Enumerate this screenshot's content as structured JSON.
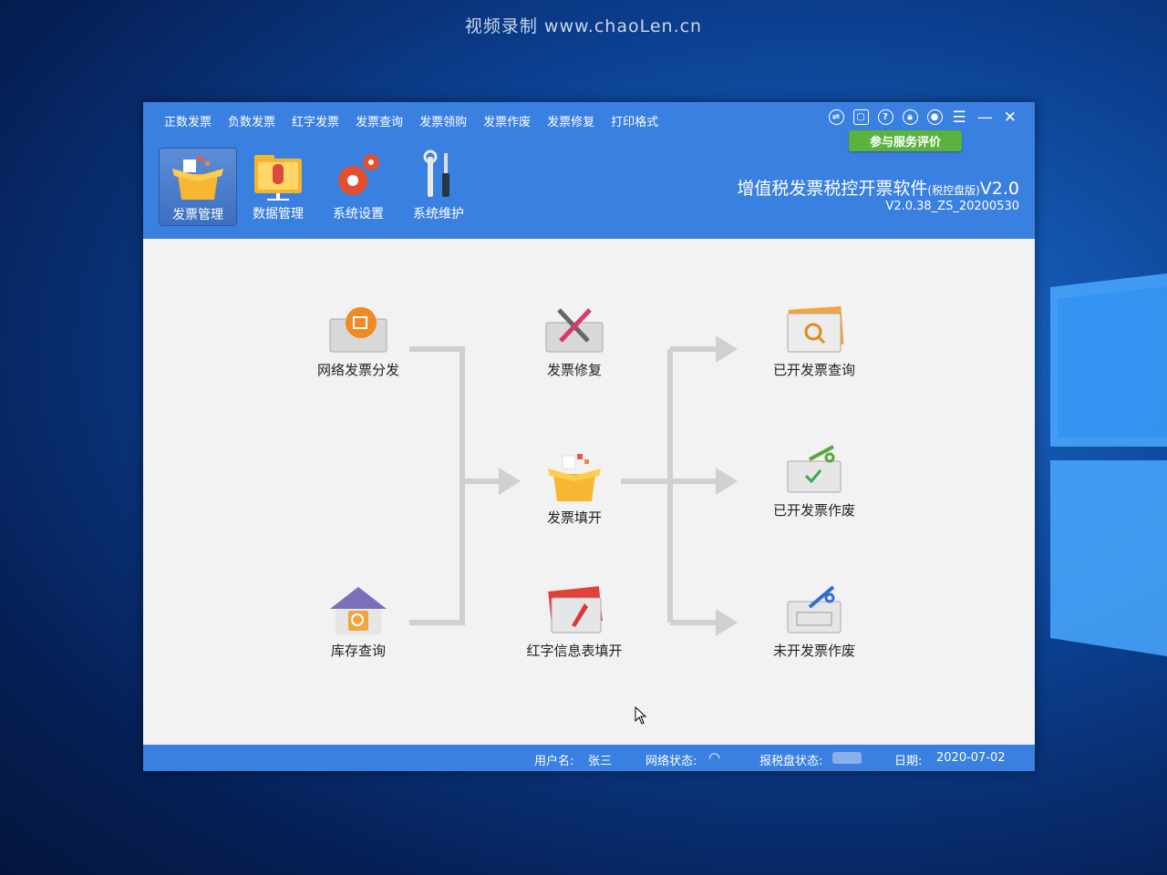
{
  "watermark": "视频录制 www.chaoLen.cn",
  "menu": [
    "正数发票",
    "负数发票",
    "红字发票",
    "发票查询",
    "发票领购",
    "发票作废",
    "发票修复",
    "打印格式"
  ],
  "eval_button": "参与服务评价",
  "toolbar": [
    {
      "label": "发票管理",
      "active": true
    },
    {
      "label": "数据管理",
      "active": false
    },
    {
      "label": "系统设置",
      "active": false
    },
    {
      "label": "系统维护",
      "active": false
    }
  ],
  "title": {
    "main": "增值税发票税控开票软件",
    "edition": "(税控盘版)",
    "version_tag": "V2.0",
    "version": "V2.0.38_ZS_20200530"
  },
  "flow": {
    "network_distribute": "网络发票分发",
    "inventory_query": "库存查询",
    "invoice_repair": "发票修复",
    "invoice_fill": "发票填开",
    "red_info_fill": "红字信息表填开",
    "issued_query": "已开发票查询",
    "issued_void": "已开发票作废",
    "unissued_void": "未开发票作废"
  },
  "status": {
    "user_label": "用户名:",
    "user": "张三",
    "network_label": "网络状态:",
    "disk_label": "报税盘状态:",
    "date_label": "日期:",
    "date": "2020-07-02"
  }
}
